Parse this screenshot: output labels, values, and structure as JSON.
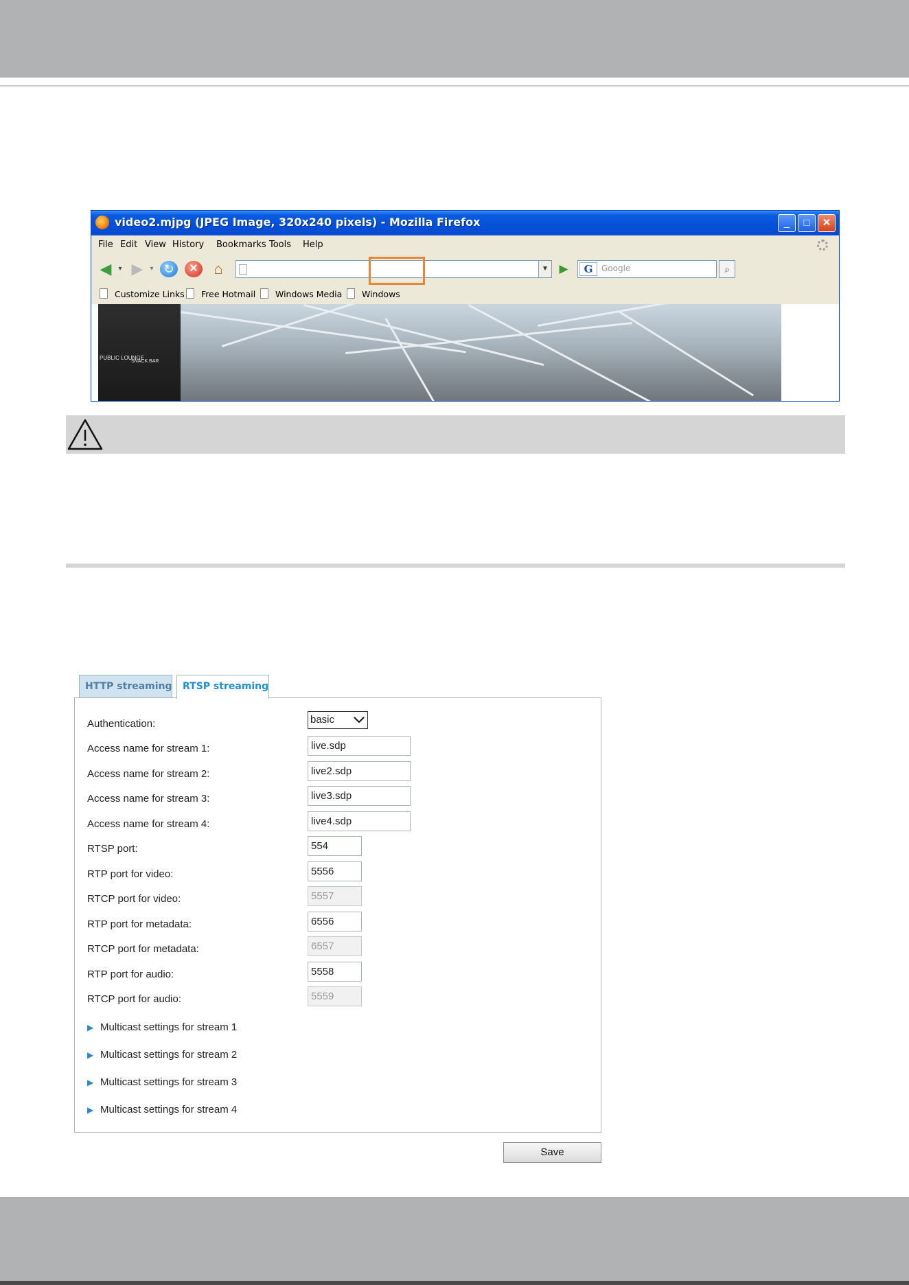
{
  "browser": {
    "title": "video2.mjpg (JPEG Image, 320x240 pixels) - Mozilla Firefox",
    "window_buttons": {
      "minimize": "_",
      "maximize": "□",
      "close": "✕"
    },
    "menu": [
      "File",
      "Edit",
      "View",
      "History",
      "Bookmarks",
      "Tools",
      "Help"
    ],
    "search_placeholder": "Google",
    "search_engine_letter": "G",
    "bookmarks": [
      "Customize Links",
      "Free Hotmail",
      "Windows Media",
      "Windows"
    ],
    "image_text": [
      "PUBLIC LOUNGE",
      "SNACK BAR"
    ]
  },
  "streaming": {
    "tabs": [
      {
        "label": "HTTP streaming",
        "active": false
      },
      {
        "label": "RTSP streaming",
        "active": true
      }
    ],
    "authentication": {
      "label": "Authentication:",
      "value": "basic"
    },
    "fields": [
      {
        "label": "Access name for stream 1:",
        "value": "live.sdp",
        "disabled": false
      },
      {
        "label": "Access name for stream 2:",
        "value": "live2.sdp",
        "disabled": false
      },
      {
        "label": "Access name for stream 3:",
        "value": "live3.sdp",
        "disabled": false
      },
      {
        "label": "Access name for stream 4:",
        "value": "live4.sdp",
        "disabled": false
      },
      {
        "label": "RTSP port:",
        "value": "554",
        "disabled": false
      },
      {
        "label": "RTP port for video:",
        "value": "5556",
        "disabled": false
      },
      {
        "label": "RTCP port for video:",
        "value": "5557",
        "disabled": true
      },
      {
        "label": "RTP port for metadata:",
        "value": "6556",
        "disabled": false
      },
      {
        "label": "RTCP port for metadata:",
        "value": "6557",
        "disabled": true
      },
      {
        "label": "RTP port for audio:",
        "value": "5558",
        "disabled": false
      },
      {
        "label": "RTCP port for audio:",
        "value": "5559",
        "disabled": true
      }
    ],
    "multicast": [
      "Multicast settings for stream 1",
      "Multicast settings for stream 2",
      "Multicast settings for stream 3",
      "Multicast settings for stream 4"
    ],
    "save_label": "Save"
  },
  "colors": {
    "band": "#b1b2b4",
    "note_bar": "#d5d5d6",
    "highlight": "#e8863a",
    "tab_active_text": "#1f8fd6",
    "tab_inactive_bg": "#cfe3f1"
  }
}
